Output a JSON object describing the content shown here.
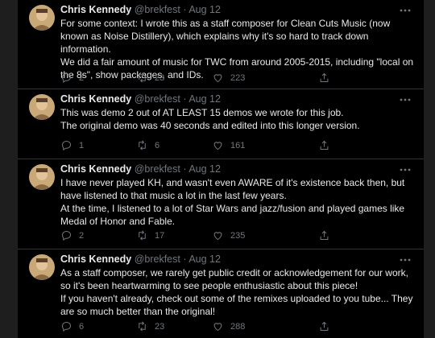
{
  "tweets": [
    {
      "name": "Chris Kennedy",
      "handle": "@brekfest",
      "dot": "·",
      "time": "Aug 12",
      "lines": [
        "For some context: I wrote this as a staff composer for Clean Cuts Music (now known as Noise Distillery), which explains why it's so hard to track down information.",
        "We did a fair amount of music for TWC from around 2005-2015, including \"local on the 8s\", show packages, and IDs."
      ],
      "replies": "2",
      "retweets": "23",
      "likes": "223"
    },
    {
      "name": "Chris Kennedy",
      "handle": "@brekfest",
      "dot": "·",
      "time": "Aug 12",
      "lines": [
        "This was demo 2 out of AT LEAST 15 demos we wrote for this job.",
        "The original demo was 40 seconds and edited into this longer version."
      ],
      "replies": "1",
      "retweets": "6",
      "likes": "161"
    },
    {
      "name": "Chris Kennedy",
      "handle": "@brekfest",
      "dot": "·",
      "time": "Aug 12",
      "lines": [
        "I have never played KH, and wasn't even AWARE of it's existence back then, but have listened to that music a lot in the last few years.",
        "At the time, I listened to a lot of Star Wars and jazz/fusion and played games like Medal of Honor and Fable."
      ],
      "replies": "2",
      "retweets": "17",
      "likes": "235"
    },
    {
      "name": "Chris Kennedy",
      "handle": "@brekfest",
      "dot": "·",
      "time": "Aug 12",
      "lines": [
        "As a staff composer, we rarely get public credit or acknowledgement for our work, so it's been heartwarming to see people enthusiastic about this piece!",
        "If you haven't already, check out some of the remixes uploaded to you tube... They are so much better than the original!"
      ],
      "replies": "6",
      "retweets": "23",
      "likes": "288"
    }
  ],
  "icons": {
    "reply": "reply-icon",
    "retweet": "retweet-icon",
    "like": "heart-icon",
    "share": "share-icon",
    "more": "more-icon"
  },
  "colors": {
    "background": "#000000",
    "text": "#e7e9ea",
    "muted": "#71767b",
    "divider": "#2f3336"
  }
}
